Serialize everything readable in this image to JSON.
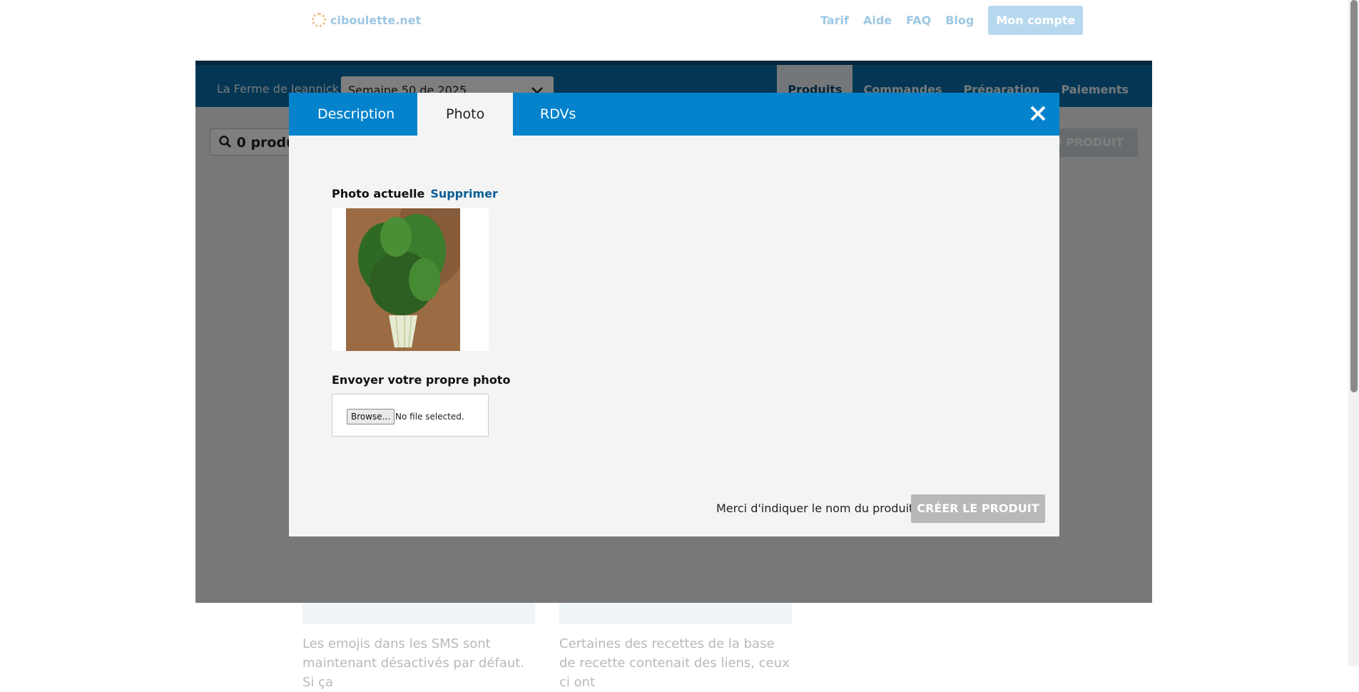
{
  "site": {
    "logo_text": "ciboulette.net",
    "nav": [
      "Tarif",
      "Aide",
      "FAQ",
      "Blog"
    ],
    "account_label": "Mon compte"
  },
  "app": {
    "farm_name": "La Ferme de Jeannick",
    "week_selected": "Semaine 50 de 2025",
    "nav": [
      "Produits",
      "Commandes",
      "Préparation",
      "Paiements"
    ],
    "active_nav": "Produits",
    "search_text": "0 produ",
    "new_product_text": "U PRODUIT"
  },
  "blog_cards": [
    {
      "text": "Les emojis dans les SMS sont maintenant désactivés par défaut. Si ça"
    },
    {
      "text": "Certaines des recettes de la base de recette contenait des liens, ceux ci ont"
    }
  ],
  "modal": {
    "tabs": [
      "Description",
      "Photo",
      "RDVs"
    ],
    "active_tab": "Photo",
    "close_icon": "close-icon",
    "current_photo_label": "Photo actuelle",
    "delete_label": "Supprimer",
    "upload_label": "Envoyer votre propre photo",
    "browse_label": "Browse...",
    "no_file_text": "No file selected.",
    "footer_message": "Merci d'indiquer le nom du produit",
    "create_label": "CRÉER LE PRODUIT"
  },
  "colors": {
    "modal_header": "#0483cc",
    "app_bar": "#0b6ea8",
    "link": "#0a5e97",
    "disabled_button": "#b8b8b8"
  }
}
